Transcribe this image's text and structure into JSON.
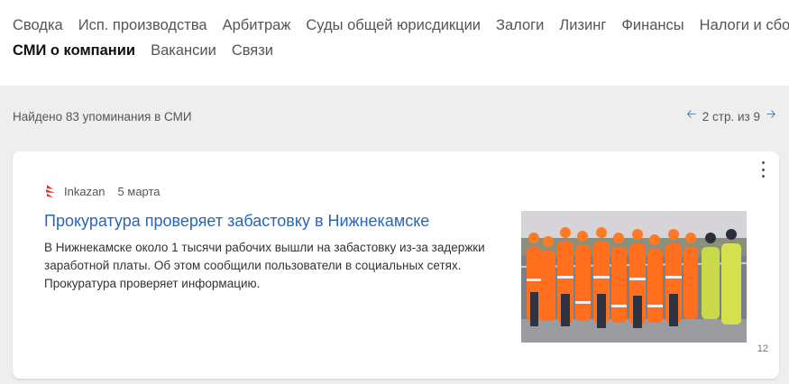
{
  "nav": {
    "row1": [
      "Сводка",
      "Исп. производства",
      "Арбитраж",
      "Суды общей юрисдикции",
      "Залоги",
      "Лизинг",
      "Финансы",
      "Налоги и сборы"
    ],
    "row2": [
      "СМИ о компании",
      "Вакансии",
      "Связи"
    ],
    "active": "СМИ о компании"
  },
  "summary": {
    "found_text": "Найдено 83 упоминания в СМИ",
    "pager_text": "2 стр. из 9",
    "prev_icon": "arrow-left-icon",
    "next_icon": "arrow-right-icon"
  },
  "article": {
    "source": "Inkazan",
    "date": "5 марта",
    "title": "Прокуратура проверяет забастовку в Нижнекамске",
    "text": "В Нижнекамске около 1 тысячи рабочих вышли на забастовку из-за задержки заработной платы. Об этом сообщили пользователи в социальных сетях. Прокуратура проверяет информацию.",
    "count": "12",
    "menu_icon": "more-vertical-icon",
    "logo_icon": "inkazan-logo-icon",
    "image": "workers-photo"
  },
  "colors": {
    "link": "#2b66b1",
    "arrow": "#2b5e9e",
    "background": "#eeeeee",
    "logo": "#e53935"
  }
}
